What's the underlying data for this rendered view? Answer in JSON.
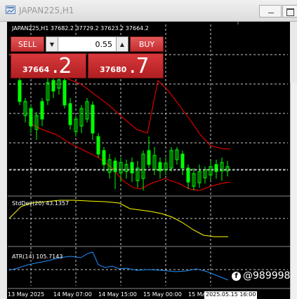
{
  "window": {
    "title": "JAPAN225,H1"
  },
  "chart": {
    "header": "JAPAN225,H1  37682.2 37729.2 37623.2 37664.2",
    "stddev_label": "StdDev(20) 43.1357",
    "atr_label": "ATR(14) 105.7143",
    "time_axis": [
      "13 May 2025",
      "14 May 07:00",
      "14 May 15:00",
      "15 May 00:00",
      "15 Ma"
    ],
    "time_cursor": "2025.05.15 16:00",
    "colors": {
      "background": "#000000",
      "candles": "#00ff00",
      "bands": "#ff0000",
      "stddev_line": "#ffff00",
      "atr_line": "#1e90ff",
      "grid": "#c8c8c8"
    }
  },
  "trade_panel": {
    "sell_label": "SELL",
    "buy_label": "BUY",
    "lot": "0.55",
    "bid_small": "37664",
    "bid_big": ".2",
    "ask_small": "37680",
    "ask_big": ".7"
  },
  "watermark": {
    "text": "@989998"
  }
}
